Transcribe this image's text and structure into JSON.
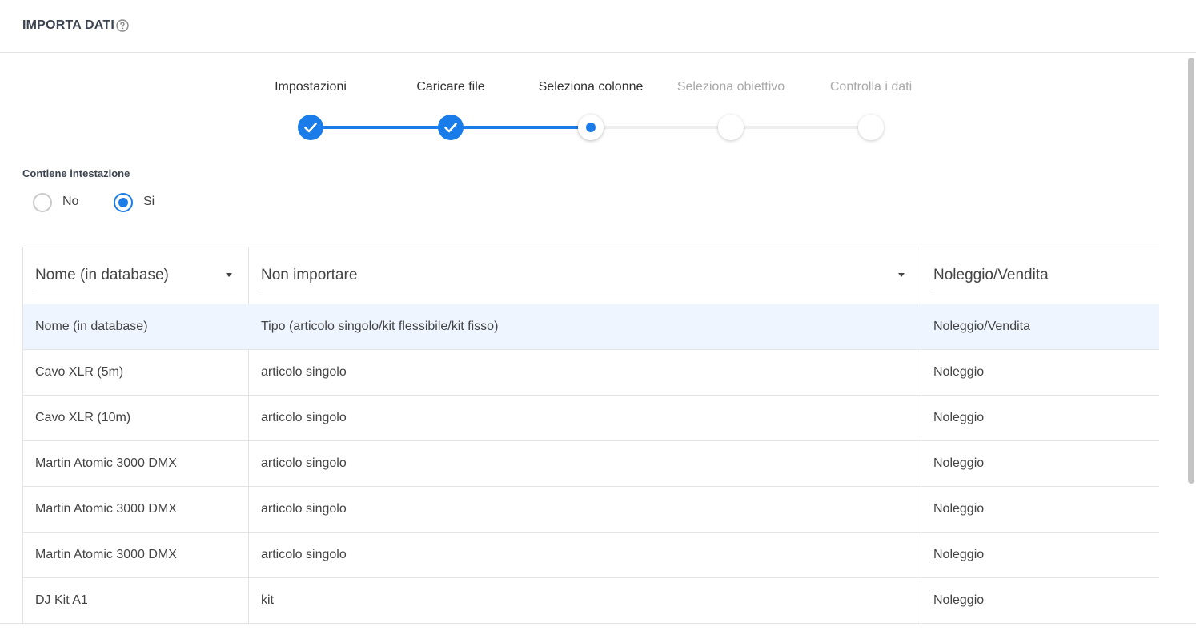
{
  "header": {
    "title": "IMPORTA DATI"
  },
  "stepper": {
    "steps": [
      {
        "label": "Impostazioni",
        "state": "done"
      },
      {
        "label": "Caricare file",
        "state": "done"
      },
      {
        "label": "Seleziona colonne",
        "state": "active"
      },
      {
        "label": "Seleziona obiettivo",
        "state": "pending"
      },
      {
        "label": "Controlla i dati",
        "state": "pending"
      }
    ]
  },
  "header_option": {
    "label": "Contiene intestazione",
    "options": [
      {
        "label": "No",
        "checked": false
      },
      {
        "label": "Si",
        "checked": true
      }
    ]
  },
  "table": {
    "column_selects": [
      "Nome (in database)",
      "Non importare",
      "Noleggio/Vendita"
    ],
    "rows": [
      [
        "Nome (in database)",
        "Tipo (articolo singolo/kit flessibile/kit fisso)",
        "Noleggio/Vendita"
      ],
      [
        "Cavo XLR (5m)",
        "articolo singolo",
        "Noleggio"
      ],
      [
        "Cavo XLR (10m)",
        "articolo singolo",
        "Noleggio"
      ],
      [
        "Martin Atomic 3000 DMX",
        "articolo singolo",
        "Noleggio"
      ],
      [
        "Martin Atomic 3000 DMX",
        "articolo singolo",
        "Noleggio"
      ],
      [
        "Martin Atomic 3000 DMX",
        "articolo singolo",
        "Noleggio"
      ],
      [
        "DJ Kit A1",
        "kit",
        "Noleggio"
      ]
    ]
  },
  "colors": {
    "accent": "#1a7ce8",
    "row_highlight": "#eef5ff"
  }
}
